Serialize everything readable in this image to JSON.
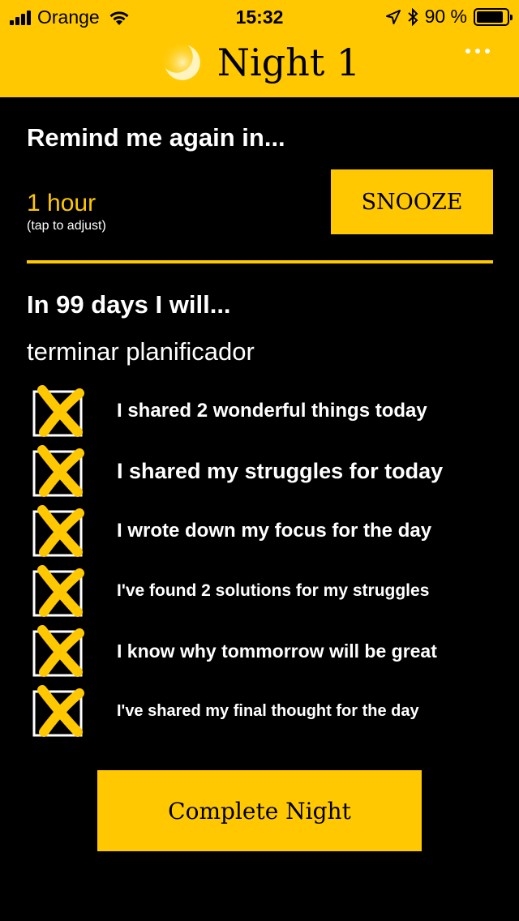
{
  "status_bar": {
    "carrier": "Orange",
    "time": "15:32",
    "battery_percent": "90 %",
    "battery_level": 0.9
  },
  "nav": {
    "title": "Night 1",
    "icons": [
      "moon-icon",
      "more-icon"
    ]
  },
  "remind": {
    "heading": "Remind me again in...",
    "duration": "1 hour",
    "hint": "(tap to adjust)",
    "snooze_label": "SNOOZE"
  },
  "goal": {
    "heading": "In 99 days I will...",
    "text": "terminar planificador"
  },
  "checklist": [
    {
      "label": "I shared 2 wonderful things today",
      "checked": true
    },
    {
      "label": "I shared my struggles for today",
      "checked": true
    },
    {
      "label": "I wrote down my focus for the day",
      "checked": true
    },
    {
      "label": "I've found 2 solutions for my struggles",
      "checked": true
    },
    {
      "label": "I know why tommorrow will be great",
      "checked": true
    },
    {
      "label": "I've shared my final thought for the day",
      "checked": true
    }
  ],
  "complete_label": "Complete Night",
  "colors": {
    "accent": "#FFC800",
    "background": "#000000",
    "text": "#FFFFFF"
  }
}
